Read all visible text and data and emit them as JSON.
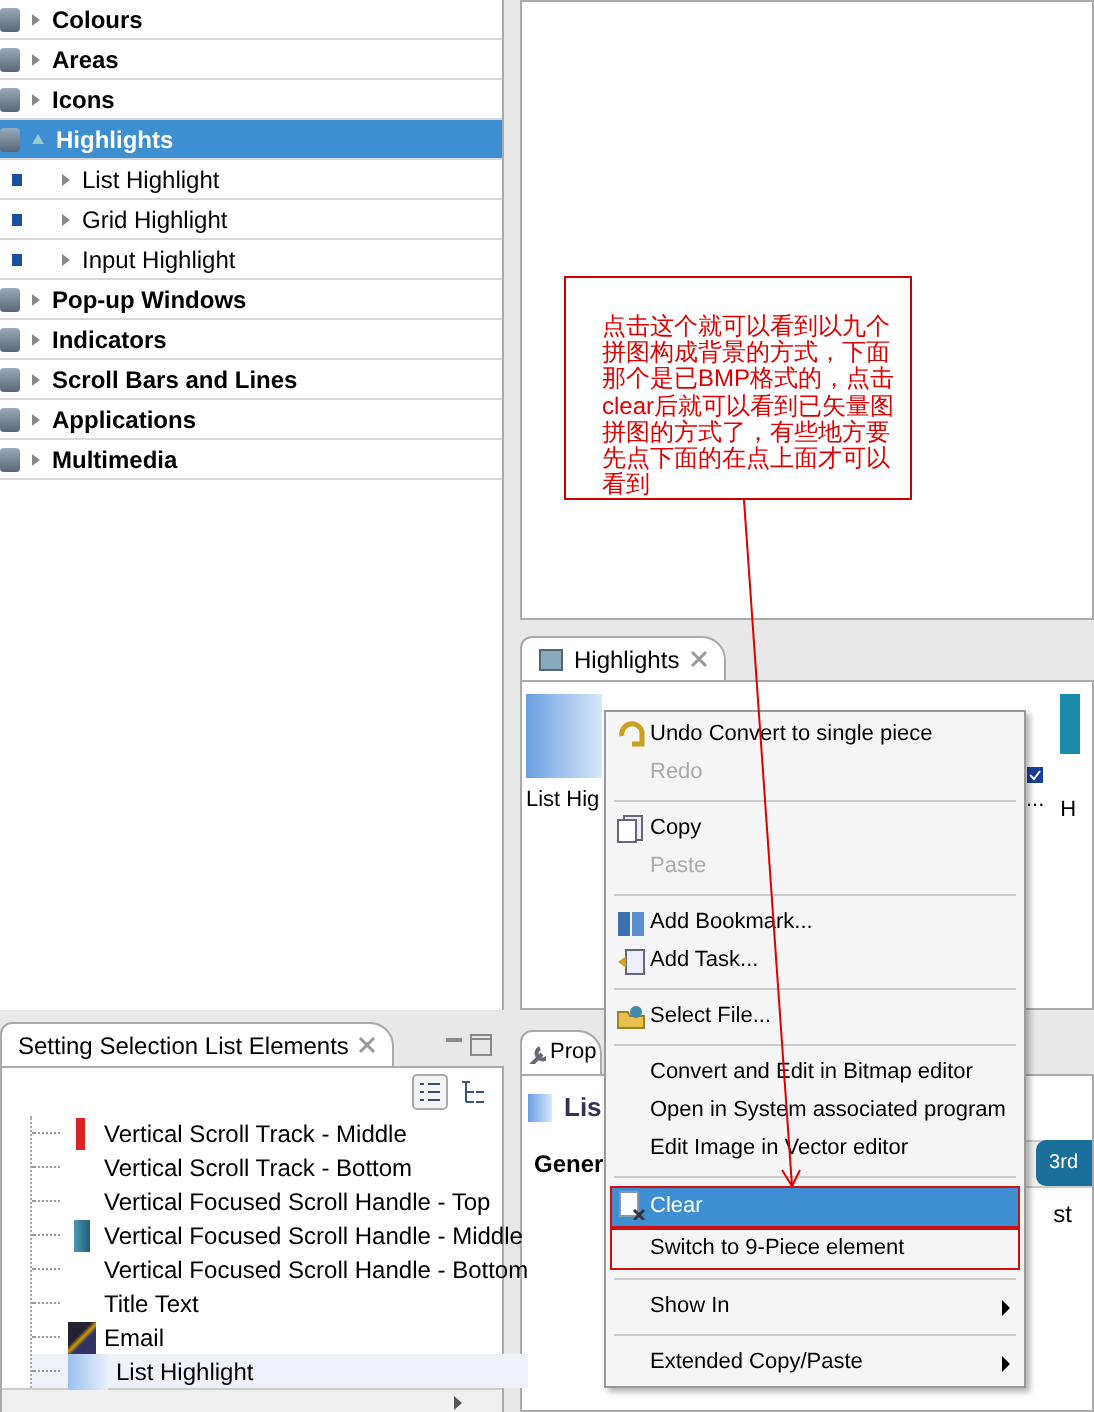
{
  "element_tree": [
    {
      "label": "Colours",
      "expanded": false,
      "selected": false
    },
    {
      "label": "Areas",
      "expanded": false,
      "selected": false
    },
    {
      "label": "Icons",
      "expanded": false,
      "selected": false
    },
    {
      "label": "Highlights",
      "expanded": true,
      "selected": true,
      "children": [
        {
          "label": "List Highlight",
          "expanded": false,
          "selected": false
        },
        {
          "label": "Grid Highlight",
          "expanded": false,
          "selected": false
        },
        {
          "label": "Input Highlight",
          "expanded": false,
          "selected": false
        }
      ]
    },
    {
      "label": "Pop-up Windows",
      "expanded": false,
      "selected": false
    },
    {
      "label": "Indicators",
      "expanded": false,
      "selected": false
    },
    {
      "label": "Scroll Bars and Lines",
      "expanded": false,
      "selected": false
    },
    {
      "label": "Applications",
      "expanded": false,
      "selected": false
    },
    {
      "label": "Multimedia",
      "expanded": false,
      "selected": false
    }
  ],
  "annotation": {
    "text": "点击这个就可以看到以九个拼图构成背景的方式，下面那个是已BMP格式的，点击clear后就可以看到已矢量图拼图的方式了，有些地方要先点下面的在点上面才可以看到"
  },
  "highlights_view": {
    "tab": "Highlights",
    "items": [
      {
        "label": "List Hig"
      },
      {
        "label": "..."
      },
      {
        "label": "H"
      }
    ]
  },
  "selection_list_view": {
    "tab": "Setting Selection List Elements",
    "items": [
      {
        "label": "Vertical Scroll Track - Middle",
        "selected": false
      },
      {
        "label": "Vertical Scroll Track - Bottom",
        "selected": false
      },
      {
        "label": "Vertical Focused Scroll Handle - Top",
        "selected": false
      },
      {
        "label": "Vertical Focused Scroll Handle - Middle",
        "selected": false
      },
      {
        "label": "Vertical Focused Scroll Handle - Bottom",
        "selected": false
      },
      {
        "label": "Title Text",
        "selected": false
      },
      {
        "label": "Email",
        "selected": false
      },
      {
        "label": "List Highlight",
        "selected": true
      }
    ]
  },
  "properties_view": {
    "tab": "Prop",
    "element": "Lis",
    "section_tab": "Gener",
    "button": "3rd",
    "cell": "st"
  },
  "context_menu": [
    {
      "kind": "item",
      "label": "Undo Convert to single piece",
      "disabled": false,
      "selected": false,
      "outlined": false,
      "submenu": false
    },
    {
      "kind": "item",
      "label": "Redo",
      "disabled": true,
      "selected": false,
      "outlined": false,
      "submenu": false
    },
    {
      "kind": "separator"
    },
    {
      "kind": "item",
      "label": "Copy",
      "disabled": false,
      "selected": false,
      "outlined": false,
      "submenu": false
    },
    {
      "kind": "item",
      "label": "Paste",
      "disabled": true,
      "selected": false,
      "outlined": false,
      "submenu": false
    },
    {
      "kind": "separator"
    },
    {
      "kind": "item",
      "label": "Add Bookmark...",
      "disabled": false,
      "selected": false,
      "outlined": false,
      "submenu": false
    },
    {
      "kind": "item",
      "label": "Add Task...",
      "disabled": false,
      "selected": false,
      "outlined": false,
      "submenu": false
    },
    {
      "kind": "separator"
    },
    {
      "kind": "item",
      "label": "Select File...",
      "disabled": false,
      "selected": false,
      "outlined": false,
      "submenu": false
    },
    {
      "kind": "separator"
    },
    {
      "kind": "item",
      "label": "Convert and Edit in Bitmap editor",
      "disabled": false,
      "selected": false,
      "outlined": false,
      "submenu": false
    },
    {
      "kind": "item",
      "label": "Open in System associated program",
      "disabled": false,
      "selected": false,
      "outlined": false,
      "submenu": false
    },
    {
      "kind": "item",
      "label": "Edit Image in Vector editor",
      "disabled": false,
      "selected": false,
      "outlined": false,
      "submenu": false
    },
    {
      "kind": "separator"
    },
    {
      "kind": "item",
      "label": "Clear",
      "disabled": false,
      "selected": true,
      "outlined": true,
      "submenu": false
    },
    {
      "kind": "item",
      "label": "Switch to 9-Piece element",
      "disabled": false,
      "selected": false,
      "outlined": true,
      "submenu": false
    },
    {
      "kind": "separator"
    },
    {
      "kind": "item",
      "label": "Show In",
      "disabled": false,
      "selected": false,
      "outlined": false,
      "submenu": true
    },
    {
      "kind": "separator"
    },
    {
      "kind": "item",
      "label": "Extended Copy/Paste",
      "disabled": false,
      "selected": false,
      "outlined": false,
      "submenu": true
    }
  ]
}
